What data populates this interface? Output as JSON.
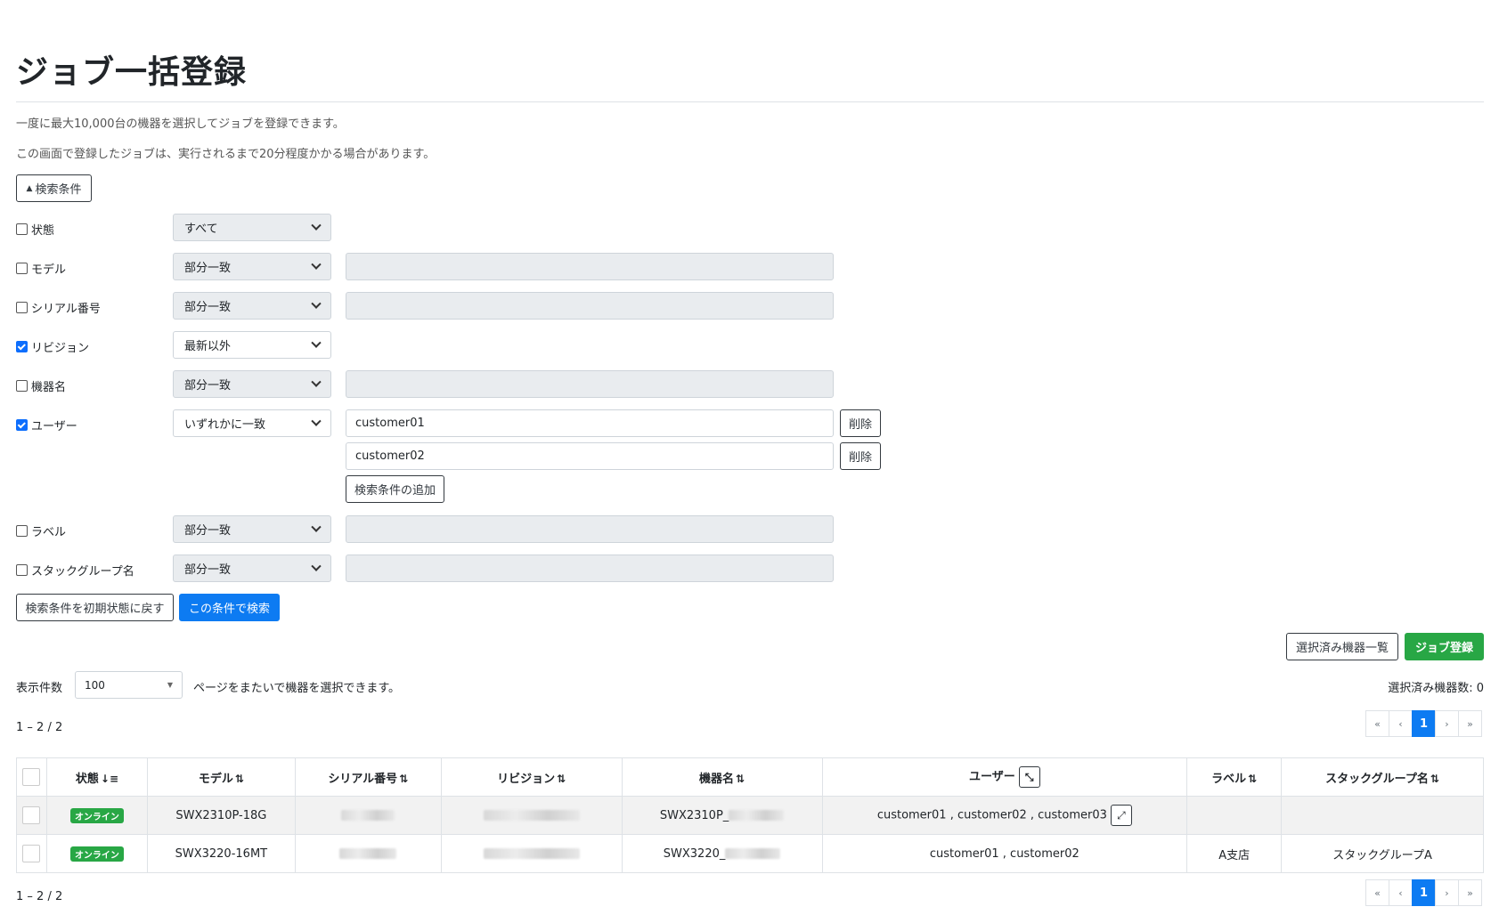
{
  "page": {
    "title": "ジョブ一括登録",
    "note1": "一度に最大10,000台の機器を選択してジョブを登録できます。",
    "note2": "この画面で登録したジョブは、実行されるまで20分程度かかる場合があります。",
    "toggle_label": "検索条件"
  },
  "filters": {
    "status": {
      "label": "状態",
      "checked": false,
      "select": "すべて"
    },
    "model": {
      "label": "モデル",
      "checked": false,
      "select": "部分一致",
      "value": ""
    },
    "serial": {
      "label": "シリアル番号",
      "checked": false,
      "select": "部分一致",
      "value": ""
    },
    "revision": {
      "label": "リビジョン",
      "checked": true,
      "select": "最新以外"
    },
    "device_name": {
      "label": "機器名",
      "checked": false,
      "select": "部分一致",
      "value": ""
    },
    "user": {
      "label": "ユーザー",
      "checked": true,
      "select": "いずれかに一致",
      "values": [
        "customer01",
        "customer02"
      ],
      "delete_label": "削除",
      "add_label": "検索条件の追加"
    },
    "label": {
      "label": "ラベル",
      "checked": false,
      "select": "部分一致",
      "value": ""
    },
    "stack_group": {
      "label": "スタックグループ名",
      "checked": false,
      "select": "部分一致",
      "value": ""
    },
    "reset_label": "検索条件を初期状態に戻す",
    "search_label": "この条件で検索"
  },
  "actions": {
    "selected_list_label": "選択済み機器一覧",
    "register_label": "ジョブ登録",
    "per_page_label": "表示件数",
    "per_page_value": "100",
    "cross_page_note": "ページをまたいで機器を選択できます。",
    "selected_count_label": "選択済み機器数: 0",
    "range_top": "1 – 2 / 2",
    "range_bottom": "1 – 2 / 2"
  },
  "pager": {
    "first": "«",
    "prev": "‹",
    "current": "1",
    "next": "›",
    "last": "»"
  },
  "table": {
    "headers": {
      "status": "状態",
      "model": "モデル",
      "serial": "シリアル番号",
      "revision": "リビジョン",
      "device_name": "機器名",
      "user": "ユーザー",
      "label": "ラベル",
      "stack_group": "スタックグループ名"
    },
    "rows": [
      {
        "status": "オンライン",
        "model": "SWX2310P-18G",
        "device_name": "SWX2310P_",
        "users": "customer01 , customer02 , customer03",
        "label": "",
        "stack_group": ""
      },
      {
        "status": "オンライン",
        "model": "SWX3220-16MT",
        "device_name": "SWX3220_",
        "users": "customer01 , customer02",
        "label": "A支店",
        "stack_group": "スタックグループA"
      }
    ]
  }
}
